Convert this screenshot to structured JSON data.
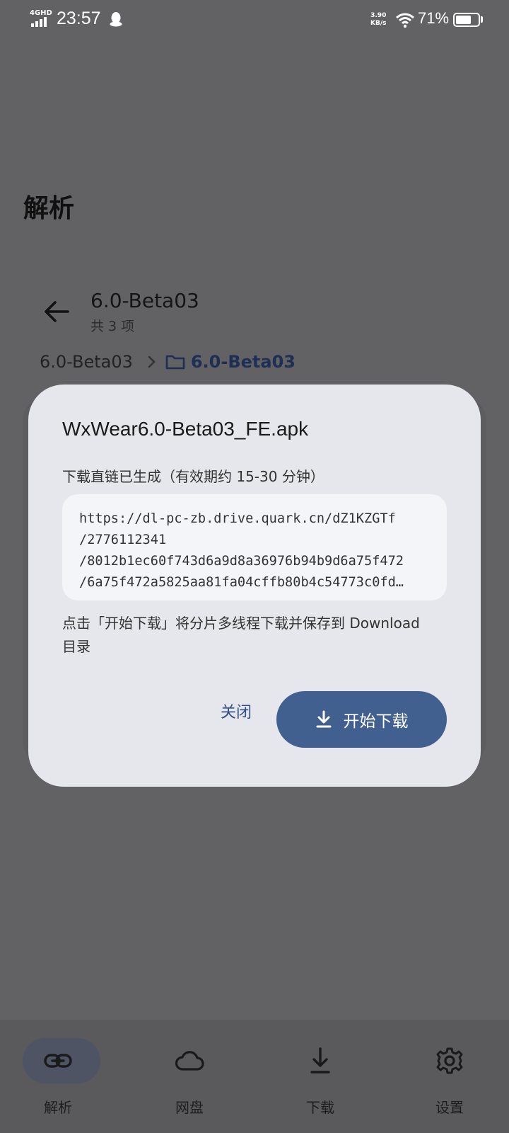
{
  "status_bar": {
    "network": "4GHD",
    "time": "23:57",
    "speed_value": "3.90",
    "speed_unit": "KB/s",
    "battery": "71%",
    "battery_level": 0.71
  },
  "page": {
    "title": "解析",
    "folder_title": "6.0-Beta03",
    "folder_count": "共 3 项",
    "breadcrumb": [
      "6.0-Beta03",
      "6.0-Beta03"
    ]
  },
  "dialog": {
    "title": "WxWear6.0-Beta03_FE.apk",
    "subtitle": "下载直链已生成（有效期约 15-30 分钟）",
    "link_lines": [
      "https://dl-pc-zb.drive.quark.cn/dZ1KZGTf",
      "/2776112341",
      "/8012b1ec60f743d6a9d8a36976b94b9d6a75f472",
      "/6a75f472a5825aa81fa04cffb80b4c54773c0fd…"
    ],
    "note": "点击「开始下载」将分片多线程下载并保存到 Download 目录",
    "close_label": "关闭",
    "start_label": "开始下载"
  },
  "bottom_nav": {
    "items": [
      {
        "label": "解析",
        "icon": "link-icon",
        "active": true
      },
      {
        "label": "网盘",
        "icon": "cloud-icon",
        "active": false
      },
      {
        "label": "下载",
        "icon": "download-icon",
        "active": false
      },
      {
        "label": "设置",
        "icon": "gear-icon",
        "active": false
      }
    ]
  },
  "colors": {
    "accent": "#42608f",
    "dialog_bg": "#e6e7ec",
    "scrim": "#626264"
  }
}
